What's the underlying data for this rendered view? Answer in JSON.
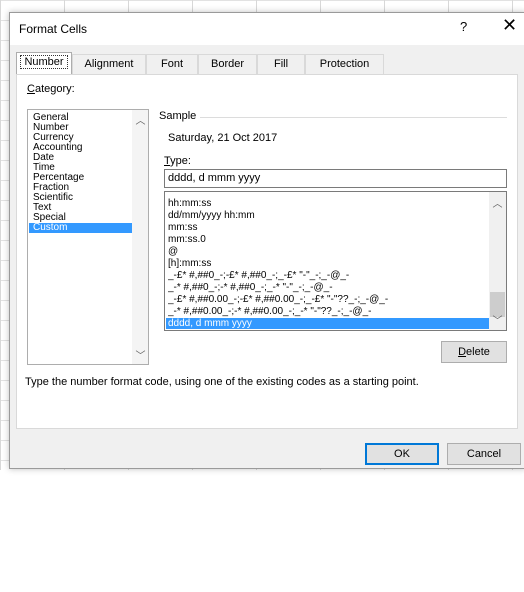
{
  "dialog": {
    "title": "Format Cells",
    "help_label": "?",
    "close_label": "✕"
  },
  "tabs": [
    {
      "label": "Number",
      "active": true
    },
    {
      "label": "Alignment",
      "active": false
    },
    {
      "label": "Font",
      "active": false
    },
    {
      "label": "Border",
      "active": false
    },
    {
      "label": "Fill",
      "active": false
    },
    {
      "label": "Protection",
      "active": false
    }
  ],
  "category": {
    "label_prefix": "C",
    "label_rest": "ategory:",
    "items": [
      "General",
      "Number",
      "Currency",
      "Accounting",
      "Date",
      "Time",
      "Percentage",
      "Fraction",
      "Scientific",
      "Text",
      "Special",
      "Custom"
    ],
    "selected": "Custom"
  },
  "sample": {
    "label": "Sample",
    "value": "Saturday, 21 Oct 2017"
  },
  "type": {
    "label_prefix": "T",
    "label_rest": "ype:",
    "value": "dddd, d mmm yyyy",
    "formats": [
      "hh:mm:ss",
      "dd/mm/yyyy hh:mm",
      "mm:ss",
      "mm:ss.0",
      "@",
      "[h]:mm:ss",
      "_-£* #,##0_-;-£* #,##0_-;_-£* \"-\"_-;_-@_-",
      "_-* #,##0_-;-* #,##0_-;_-* \"-\"_-;_-@_-",
      "_-£* #,##0.00_-;-£* #,##0.00_-;_-£* \"-\"??_-;_-@_-",
      "_-* #,##0.00_-;-* #,##0.00_-;_-* \"-\"??_-;_-@_-",
      "dddd, d mmm yyyy"
    ],
    "selected": "dddd, d mmm yyyy"
  },
  "delete_label": "Delete",
  "description": "Type the number format code, using one of the existing codes as a starting point.",
  "ok_label": "OK",
  "cancel_label": "Cancel",
  "colors": {
    "selection": "#3399ff",
    "primary_border": "#0078d7"
  }
}
